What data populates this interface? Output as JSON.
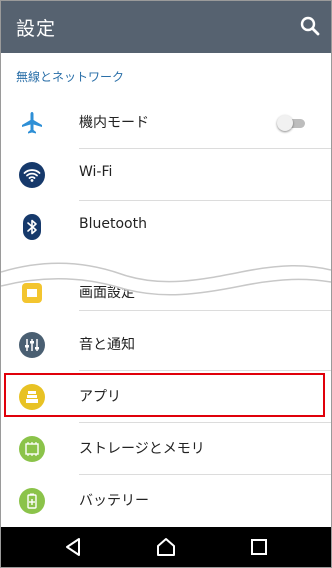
{
  "header": {
    "title": "設定"
  },
  "section": {
    "title": "無線とネットワーク"
  },
  "items": [
    {
      "label": "機内モード",
      "icon": "airplane-icon",
      "toggle": "off"
    },
    {
      "label": "Wi-Fi",
      "icon": "wifi-icon"
    },
    {
      "label": "Bluetooth",
      "icon": "bluetooth-icon"
    },
    {
      "label": "画面設定",
      "icon": "display-icon"
    },
    {
      "label": "音と通知",
      "icon": "sound-icon"
    },
    {
      "label": "アプリ",
      "icon": "apps-icon",
      "highlighted": true
    },
    {
      "label": "ストレージとメモリ",
      "icon": "storage-icon"
    },
    {
      "label": "バッテリー",
      "icon": "battery-icon"
    }
  ],
  "navbar": {
    "buttons": [
      "back-icon",
      "home-icon",
      "recents-icon"
    ]
  },
  "colors": {
    "topbar": "#566270",
    "section_header": "#2a6fa8",
    "highlight_border": "#e0000a",
    "navbar": "#000000"
  }
}
